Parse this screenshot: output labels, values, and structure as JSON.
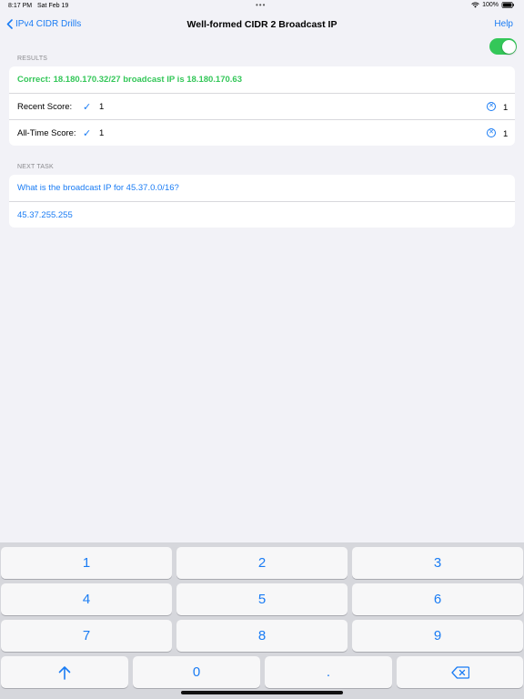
{
  "status": {
    "time": "8:17 PM",
    "date": "Sat Feb 19",
    "battery": "100%"
  },
  "nav": {
    "back_label": "IPv4 CIDR Drills",
    "title": "Well-formed CIDR 2 Broadcast IP",
    "help_label": "Help"
  },
  "toggle": {
    "on": true,
    "color": "#34c759"
  },
  "results": {
    "header": "RESULTS",
    "message": "Correct: 18.180.170.32/27 broadcast IP is 18.180.170.63",
    "recent": {
      "label": "Recent Score:",
      "correct": "1",
      "wrong": "1"
    },
    "all_time": {
      "label": "All-Time Score:",
      "correct": "1",
      "wrong": "1"
    }
  },
  "next_task": {
    "header": "NEXT TASK",
    "question": "What is the broadcast IP for  45.37.0.0/16?",
    "answer": "45.37.255.255"
  },
  "keyboard": {
    "keys": [
      "1",
      "2",
      "3",
      "4",
      "5",
      "6",
      "7",
      "8",
      "9"
    ],
    "zero": "0",
    "dot": ".",
    "shift_icon": "arrow-up-icon",
    "delete_icon": "delete-icon"
  },
  "colors": {
    "accent": "#1a7cf4",
    "success": "#34c759",
    "background": "#f2f2f7",
    "keyboard": "#d6d7dc"
  }
}
